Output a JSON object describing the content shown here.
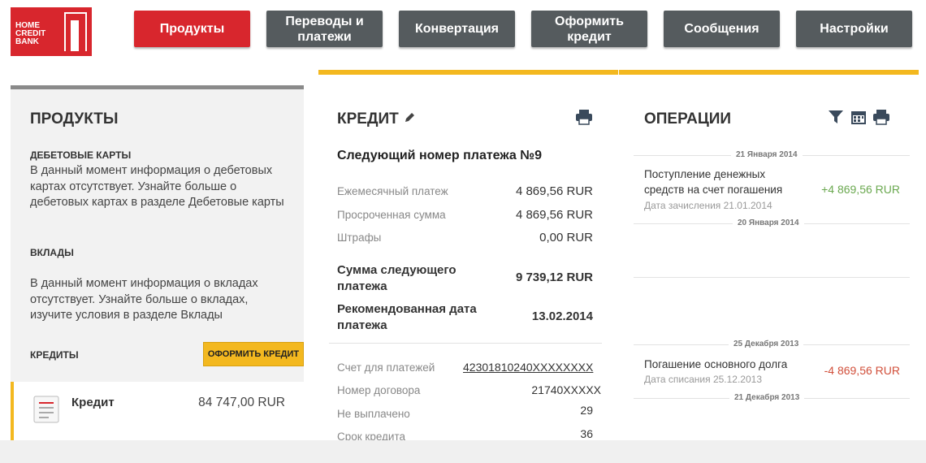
{
  "logo": {
    "text": "HOME\nCREDIT\nBANK"
  },
  "nav": [
    {
      "label": "Продукты"
    },
    {
      "label": "Переводы и платежи"
    },
    {
      "label": "Конвертация"
    },
    {
      "label": "Оформить кредит"
    },
    {
      "label": "Сообщения"
    },
    {
      "label": "Настройки"
    }
  ],
  "colors": {
    "brand_red": "#d8262d",
    "accent_yellow": "#f3b81f",
    "nav_gray": "#555b5e",
    "positive": "#6aa84f",
    "negative": "#d14f3a"
  },
  "products": {
    "title": "ПРОДУКТЫ",
    "debit": {
      "heading": "ДЕБЕТОВЫЕ КАРТЫ",
      "text": "В данный момент информация о дебетовых картах отсутствует. Узнайте больше о дебетовых картах в разделе Дебетовые карты"
    },
    "deposits": {
      "heading": "ВКЛАДЫ",
      "text": "В данный момент информация о вкладах отсутствует. Узнайте больше о вкладах, изучите условия в разделе Вклады"
    },
    "credits": {
      "heading": "КРЕДИТЫ",
      "apply_button": "ОФОРМИТЬ КРЕДИТ"
    },
    "credit_item": {
      "name": "Кредит",
      "amount": "84 747,00 RUR",
      "icon": "document-icon"
    }
  },
  "credit": {
    "title": "КРЕДИТ",
    "subtitle": "Следующий номер платежа №9",
    "rows": [
      {
        "label": "Ежемесячный платеж",
        "value": "4 869,56 RUR"
      },
      {
        "label": "Просроченная сумма",
        "value": "4 869,56 RUR"
      },
      {
        "label": "Штрафы",
        "value": "0,00 RUR"
      }
    ],
    "next_sum_label": "Сумма следующего платежа",
    "next_sum_value": "9 739,12 RUR",
    "recommended_label": "Рекомендованная дата платежа",
    "recommended_value": "13.02.2014",
    "details": [
      {
        "label": "Счет для платежей",
        "value": "42301810240XXXXXXXX"
      },
      {
        "label": "Номер договора",
        "value": "21740XXXXX"
      },
      {
        "label": "Не выплачено",
        "value": "29"
      },
      {
        "label": "Срок кредита",
        "value": "36"
      }
    ]
  },
  "operations": {
    "title": "ОПЕРАЦИИ",
    "dates": [
      "21 Января 2014",
      "20 Января 2014",
      "25 Декабря 2013",
      "21 Декабря 2013"
    ],
    "items": [
      {
        "title": "Поступление денежных средств на счет погашения",
        "sub": "Дата зачисления 21.01.2014",
        "amount": "+4 869,56 RUR"
      },
      {
        "title": "Погашение основного долга",
        "sub": "Дата списания 25.12.2013",
        "amount": "-4 869,56 RUR"
      }
    ]
  }
}
